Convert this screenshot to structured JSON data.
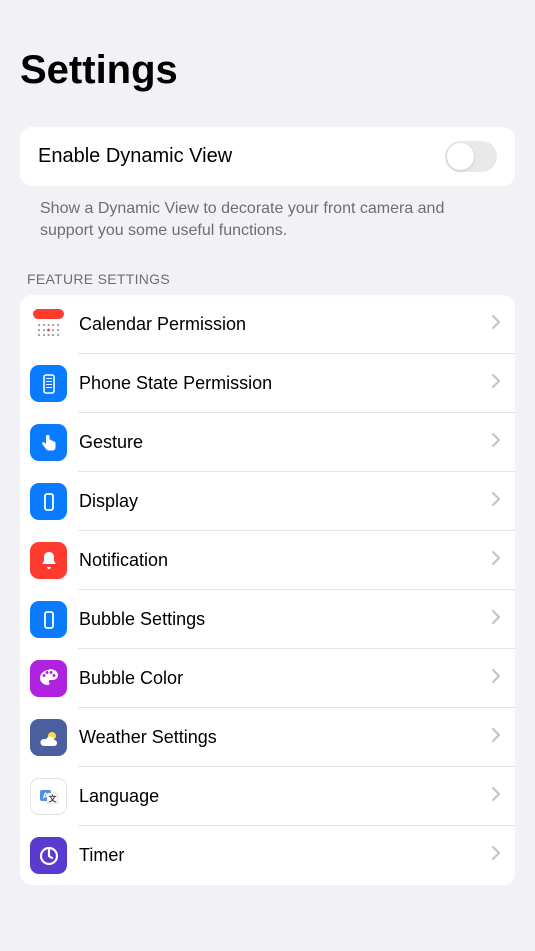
{
  "page_title": "Settings",
  "toggle_card": {
    "label": "Enable Dynamic View",
    "enabled": false,
    "description": "Show a Dynamic View to decorate your front camera and support you some useful functions."
  },
  "feature_section": {
    "header": "FEATURE SETTINGS",
    "items": [
      {
        "label": "Calendar Permission",
        "icon": "calendar-icon",
        "bg": "#ffffff",
        "bordered": false
      },
      {
        "label": "Phone State Permission",
        "icon": "phone-state-icon",
        "bg": "#0a7aff",
        "bordered": false
      },
      {
        "label": "Gesture",
        "icon": "gesture-icon",
        "bg": "#0a7aff",
        "bordered": false
      },
      {
        "label": "Display",
        "icon": "display-icon",
        "bg": "#0a7aff",
        "bordered": false
      },
      {
        "label": "Notification",
        "icon": "notification-icon",
        "bg": "#ff3b30",
        "bordered": false
      },
      {
        "label": "Bubble Settings",
        "icon": "bubble-settings-icon",
        "bg": "#0a7aff",
        "bordered": false
      },
      {
        "label": "Bubble Color",
        "icon": "bubble-color-icon",
        "bg": "#af22e0",
        "bordered": false
      },
      {
        "label": "Weather Settings",
        "icon": "weather-icon",
        "bg": "#4b5e9e",
        "bordered": false
      },
      {
        "label": "Language",
        "icon": "language-icon",
        "bg": "#ffffff",
        "bordered": true
      },
      {
        "label": "Timer",
        "icon": "timer-icon",
        "bg": "#5b3bcf",
        "bordered": false
      }
    ]
  }
}
